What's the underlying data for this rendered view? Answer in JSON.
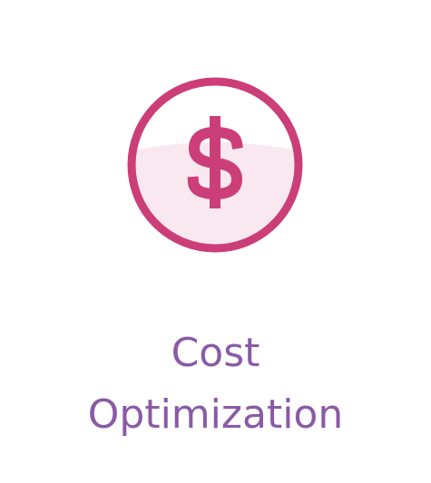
{
  "tile": {
    "icon": "dollar-circle-icon",
    "title_line1": "Cost",
    "title_line2": "Optimization"
  },
  "colors": {
    "icon_accent": "#cc3e78",
    "icon_fill": "#f9e8ef",
    "title_text": "#8a5aa6",
    "background": "#ffffff"
  }
}
